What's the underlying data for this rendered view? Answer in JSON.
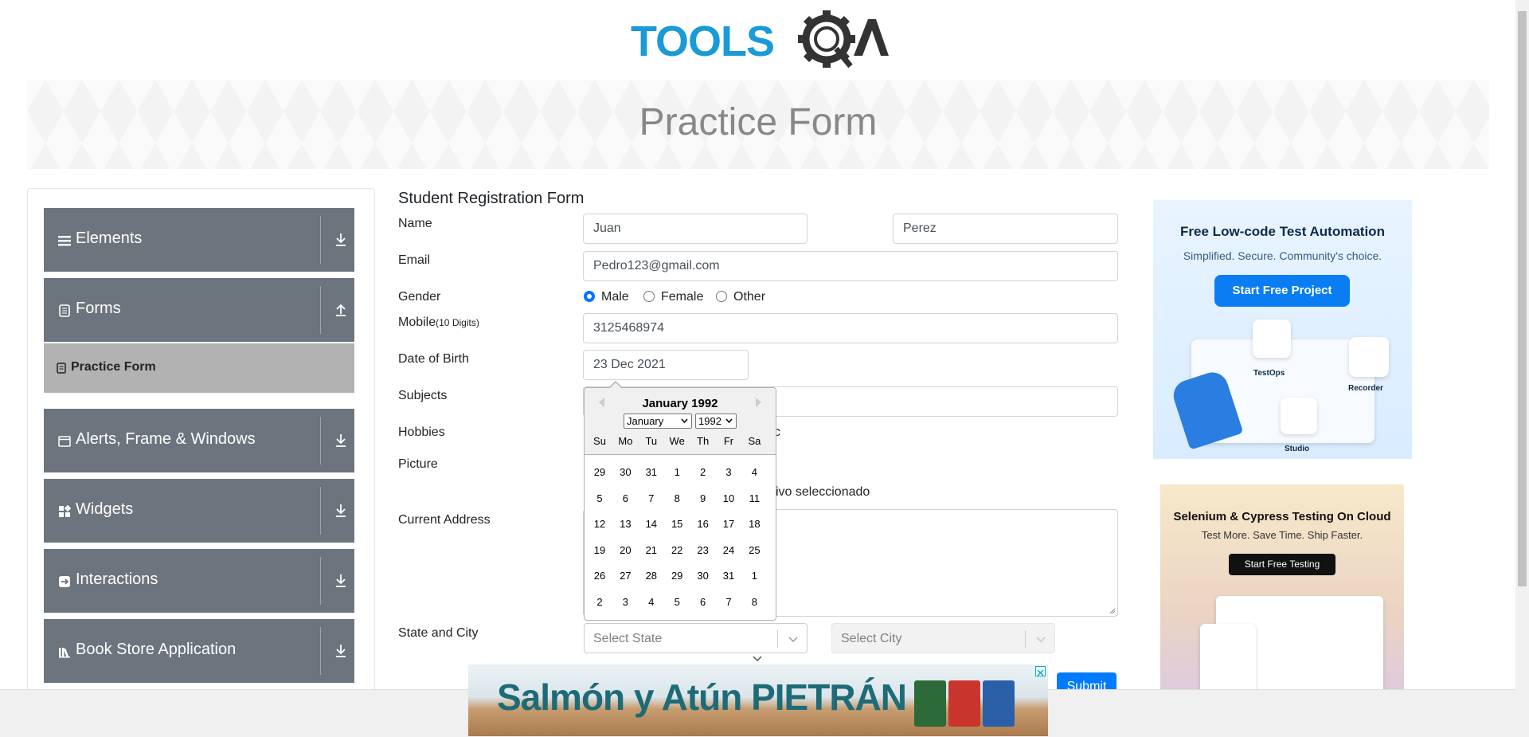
{
  "header": {
    "logo_text": "TOOLSQA",
    "banner_title": "Practice Form"
  },
  "sidebar": {
    "groups": [
      {
        "label": "Elements",
        "icon": "list-icon"
      },
      {
        "label": "Forms",
        "icon": "document-icon"
      },
      {
        "label": "Alerts, Frame & Windows",
        "icon": "window-icon"
      },
      {
        "label": "Widgets",
        "icon": "grid-icon"
      },
      {
        "label": "Interactions",
        "icon": "interaction-icon"
      },
      {
        "label": "Book Store Application",
        "icon": "books-icon"
      }
    ],
    "active_item": "Practice Form"
  },
  "form": {
    "title": "Student Registration Form",
    "labels": {
      "name": "Name",
      "email": "Email",
      "gender": "Gender",
      "mobile": "Mobile",
      "mobile_hint": "(10 Digits)",
      "dob": "Date of Birth",
      "subjects": "Subjects",
      "hobbies": "Hobbies",
      "picture": "Picture",
      "address": "Current Address",
      "state_city": "State and City"
    },
    "first_name": "Juan",
    "last_name": "Perez",
    "email": "Pedro123@gmail.com",
    "gender_options": [
      "Male",
      "Female",
      "Other"
    ],
    "gender_selected": "Male",
    "mobile": "3125468974",
    "dob": "23 Dec 2021",
    "hobbies_partial": "c",
    "picture_partial": "ivo seleccionado",
    "state_placeholder": "Select State",
    "city_placeholder": "Select City",
    "submit_label": "Submit"
  },
  "datepicker": {
    "month_title": "January 1992",
    "month_select": "January",
    "year_select": "1992",
    "day_names": [
      "Su",
      "Mo",
      "Tu",
      "We",
      "Th",
      "Fr",
      "Sa"
    ],
    "weeks": [
      [
        "29",
        "30",
        "31",
        "1",
        "2",
        "3",
        "4"
      ],
      [
        "5",
        "6",
        "7",
        "8",
        "9",
        "10",
        "11"
      ],
      [
        "12",
        "13",
        "14",
        "15",
        "16",
        "17",
        "18"
      ],
      [
        "19",
        "20",
        "21",
        "22",
        "23",
        "24",
        "25"
      ],
      [
        "26",
        "27",
        "28",
        "29",
        "30",
        "31",
        "1"
      ],
      [
        "2",
        "3",
        "4",
        "5",
        "6",
        "7",
        "8"
      ]
    ]
  },
  "ads": {
    "ad1": {
      "title": "Free Low-code Test Automation",
      "subtitle": "Simplified. Secure. Community's choice.",
      "button": "Start Free Project",
      "labels": [
        "TestOps",
        "Recorder",
        "Studio"
      ]
    },
    "ad2": {
      "title": "Selenium & Cypress Testing On Cloud",
      "subtitle": "Test More. Save Time. Ship Faster.",
      "button": "Start Free Testing"
    },
    "ad3": {
      "text": "Salmón y Atún PIETRÁN"
    }
  },
  "colors": {
    "sidebar_bg": "#6c757d",
    "active_item_bg": "#b2b2b2",
    "primary": "#007bff",
    "brand_blue": "#1a9ad6"
  }
}
